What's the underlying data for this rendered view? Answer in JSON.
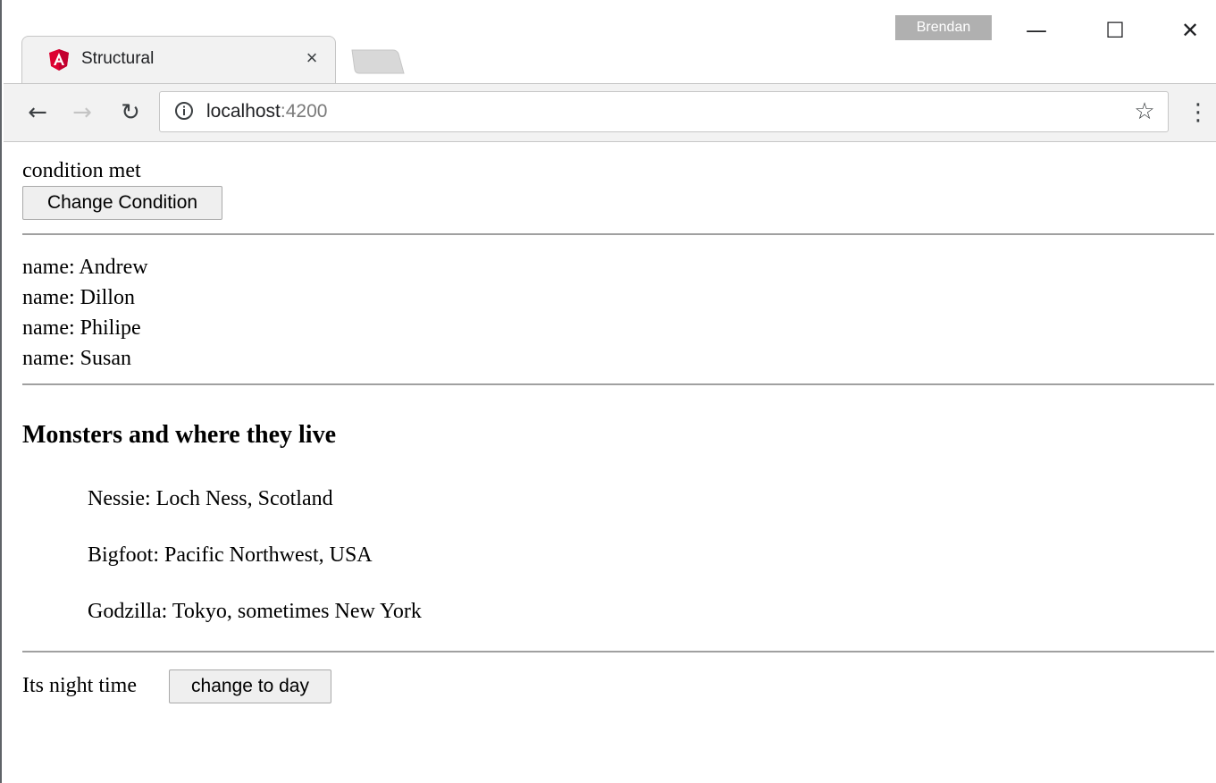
{
  "browser": {
    "tab_title": "Structural",
    "tab_close": "×",
    "profile_name": "Brendan",
    "url_host": "localhost",
    "url_port": ":4200",
    "window_buttons": {
      "minimize": "—",
      "maximize": "☐",
      "close": "✕"
    },
    "nav": {
      "back": "←",
      "forward": "→",
      "reload": "↻"
    },
    "bookmark_star": "☆",
    "menu": "⋮",
    "favicon": "angular-icon",
    "colors": {
      "favicon_red": "#dd0031",
      "profile_badge": "#b0b0b0"
    }
  },
  "page": {
    "condition_text": "condition met",
    "change_condition_label": "Change Condition",
    "names": [
      "name: Andrew",
      "name: Dillon",
      "name: Philipe",
      "name: Susan"
    ],
    "monsters_title": "Monsters and where they live",
    "monsters": [
      "Nessie: Loch Ness, Scotland",
      "Bigfoot: Pacific Northwest, USA",
      "Godzilla: Tokyo, sometimes New York"
    ],
    "night_text": "Its night time",
    "change_to_day_label": "change to day"
  }
}
